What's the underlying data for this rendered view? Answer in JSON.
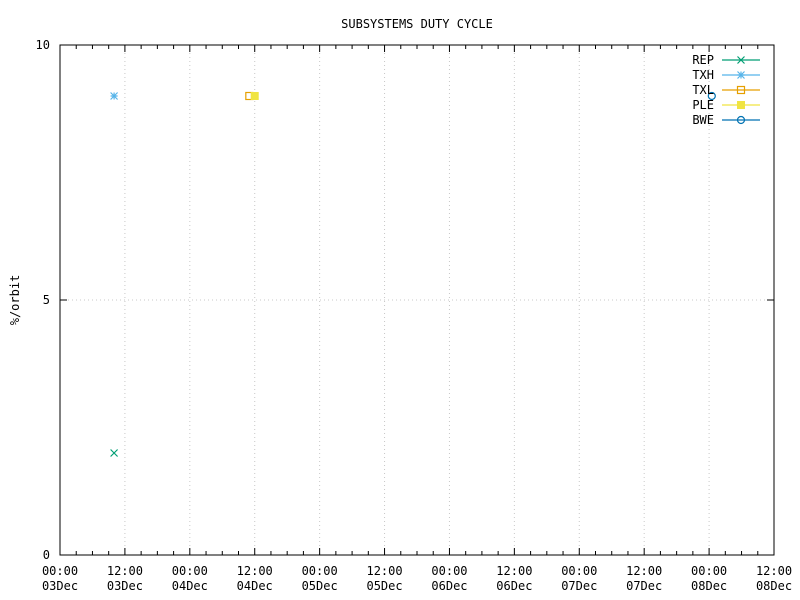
{
  "chart_data": {
    "type": "scatter",
    "title": "SUBSYSTEMS DUTY CYCLE",
    "xlabel": "",
    "ylabel": "%/orbit",
    "ylim": [
      0,
      10
    ],
    "yticks": [
      "0",
      "5",
      "10"
    ],
    "xlim": [
      "2024-12-03 00:00",
      "2024-12-08 12:00"
    ],
    "xticks": [
      {
        "time": "00:00",
        "date": "03Dec"
      },
      {
        "time": "12:00",
        "date": "03Dec"
      },
      {
        "time": "00:00",
        "date": "04Dec"
      },
      {
        "time": "12:00",
        "date": "04Dec"
      },
      {
        "time": "00:00",
        "date": "05Dec"
      },
      {
        "time": "12:00",
        "date": "05Dec"
      },
      {
        "time": "00:00",
        "date": "06Dec"
      },
      {
        "time": "12:00",
        "date": "06Dec"
      },
      {
        "time": "00:00",
        "date": "07Dec"
      },
      {
        "time": "12:00",
        "date": "07Dec"
      },
      {
        "time": "00:00",
        "date": "08Dec"
      },
      {
        "time": "12:00",
        "date": "08Dec"
      }
    ],
    "grid": true,
    "legend_position": "top-right",
    "series": [
      {
        "name": "REP",
        "color": "#009e73",
        "marker": "cross",
        "points": [
          {
            "x": "2024-12-03 10:00",
            "y": 2.0
          }
        ]
      },
      {
        "name": "TXH",
        "color": "#56b4e9",
        "marker": "asterisk",
        "points": [
          {
            "x": "2024-12-03 10:00",
            "y": 9.0
          }
        ]
      },
      {
        "name": "TXL",
        "color": "#e69f00",
        "marker": "open-square",
        "points": [
          {
            "x": "2024-12-04 11:00",
            "y": 9.0
          }
        ]
      },
      {
        "name": "PLE",
        "color": "#f0e442",
        "marker": "filled-square",
        "points": [
          {
            "x": "2024-12-04 12:00",
            "y": 9.0
          }
        ]
      },
      {
        "name": "BWE",
        "color": "#0072b2",
        "marker": "open-circle",
        "points": [
          {
            "x": "2024-12-08 00:30",
            "y": 9.0
          }
        ]
      }
    ]
  }
}
